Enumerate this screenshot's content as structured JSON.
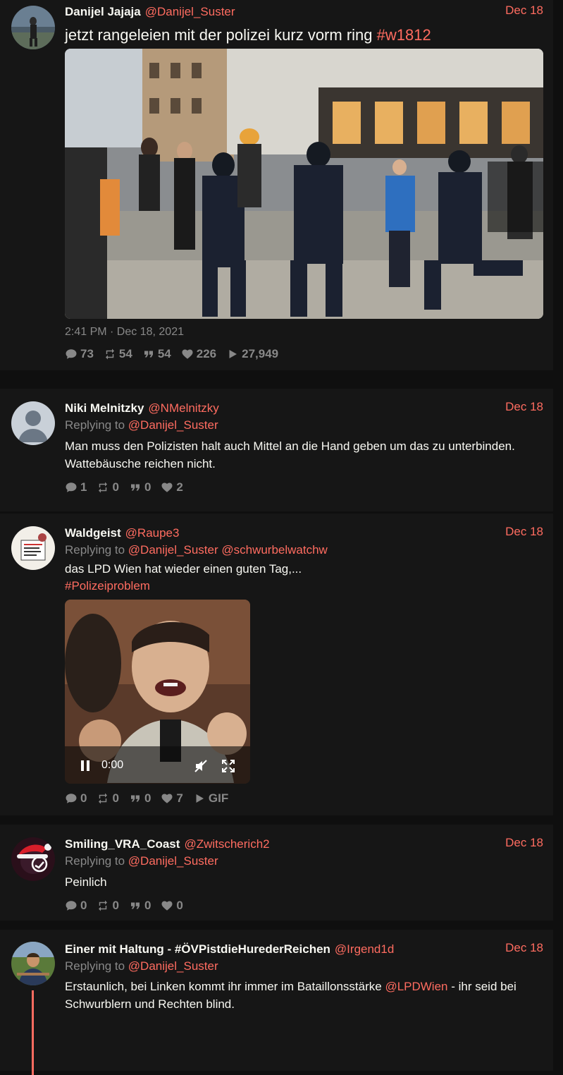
{
  "colors": {
    "accent": "#ff6c60",
    "background": "#0f0f0f",
    "card": "#161616",
    "muted": "#888888"
  },
  "main_tweet": {
    "fullname": "Danijel Jajaja",
    "username": "@Danijel_Suster",
    "date": "Dec 18",
    "text": "jetzt rangeleien mit der polizei kurz vorm ring ",
    "hashtag": "#w1812",
    "timestamp": "2:41 PM · Dec 18, 2021",
    "stats": {
      "replies": "73",
      "retweets": "54",
      "quotes": "54",
      "likes": "226",
      "views": "27,949"
    }
  },
  "replies": [
    {
      "fullname": "Niki Melnitzky",
      "username": "@NMelnitzky",
      "date": "Dec 18",
      "replying_label": "Replying to",
      "replying_to": [
        "@Danijel_Suster"
      ],
      "text": "Man muss den Polizisten halt auch Mittel an die Hand geben um das zu unterbinden. Wattebäusche reichen nicht.",
      "stats": {
        "replies": "1",
        "retweets": "0",
        "quotes": "0",
        "likes": "2"
      }
    },
    {
      "fullname": "Waldgeist",
      "username": "@Raupe3",
      "date": "Dec 18",
      "replying_label": "Replying to",
      "replying_to": [
        "@Danijel_Suster",
        "@schwurbelwatchw"
      ],
      "text": "das LPD Wien hat wieder einen guten Tag,...",
      "hashtag": "#Polizeiproblem",
      "video_time": "0:00",
      "stats": {
        "replies": "0",
        "retweets": "0",
        "quotes": "0",
        "likes": "7",
        "media": "GIF"
      }
    },
    {
      "fullname": "Smiling_VRA_Coast",
      "username": "@Zwitscherich2",
      "date": "Dec 18",
      "replying_label": "Replying to",
      "replying_to": [
        "@Danijel_Suster"
      ],
      "text": "Peinlich",
      "stats": {
        "replies": "0",
        "retweets": "0",
        "quotes": "0",
        "likes": "0"
      }
    },
    {
      "fullname": "Einer mit Haltung - #ÖVPistdieHurederReichen",
      "username": "@Irgend1d",
      "date": "Dec 18",
      "replying_label": "Replying to",
      "replying_to": [
        "@Danijel_Suster"
      ],
      "text_pre": "Erstaunlich, bei Linken kommt ihr immer im Bataillonsstärke ",
      "mention": "@LPDWien",
      "text_post": " - ihr seid bei Schwurblern und Rechten blind."
    }
  ]
}
